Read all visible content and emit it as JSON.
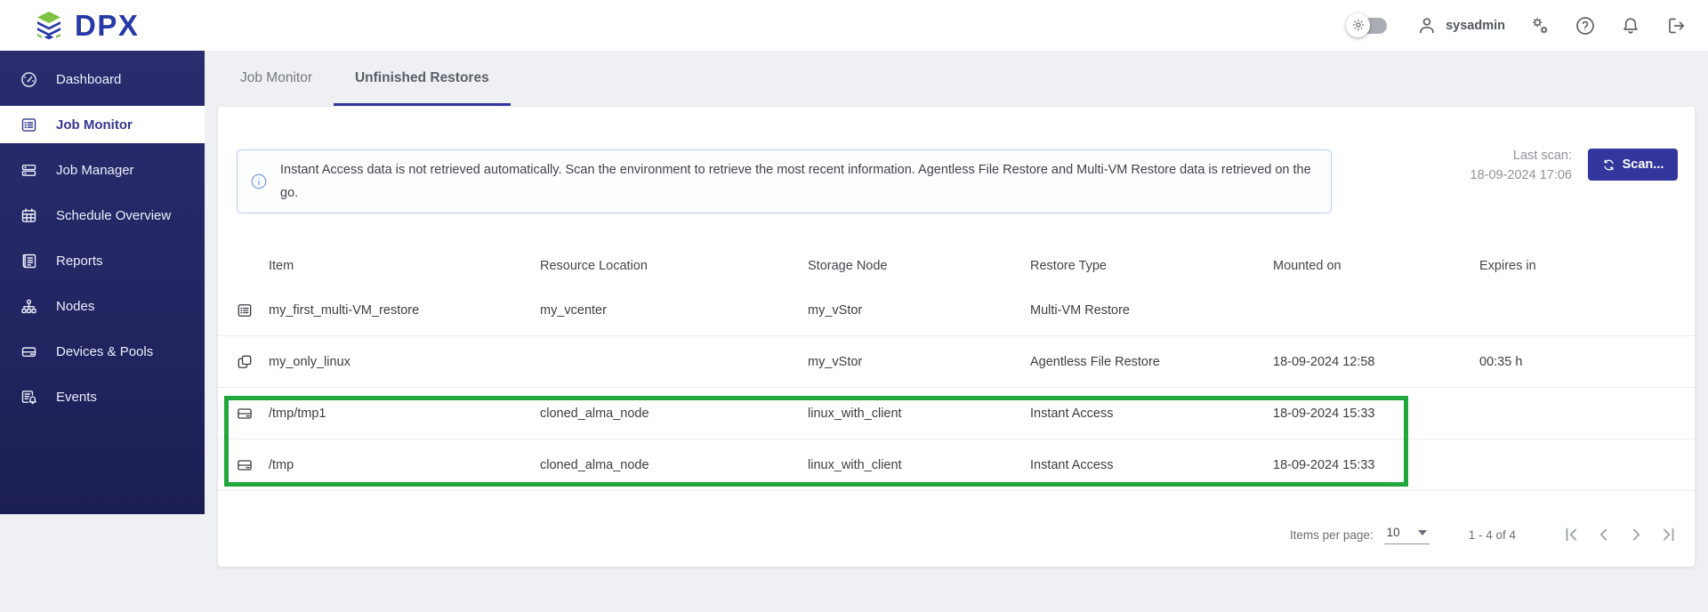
{
  "brand": {
    "name": "DPX"
  },
  "topbar": {
    "username": "sysadmin"
  },
  "sidebar": {
    "items": [
      {
        "label": "Dashboard",
        "active": false
      },
      {
        "label": "Job Monitor",
        "active": true
      },
      {
        "label": "Job Manager",
        "active": false
      },
      {
        "label": "Schedule Overview",
        "active": false
      },
      {
        "label": "Reports",
        "active": false
      },
      {
        "label": "Nodes",
        "active": false
      },
      {
        "label": "Devices & Pools",
        "active": false
      },
      {
        "label": "Events",
        "active": false
      }
    ]
  },
  "tabs": [
    {
      "label": "Job Monitor",
      "active": false
    },
    {
      "label": "Unfinished Restores",
      "active": true
    }
  ],
  "banner": {
    "text": "Instant Access data is not retrieved automatically. Scan the environment to retrieve the most recent information. Agentless File Restore and Multi-VM Restore data is retrieved on the go."
  },
  "scan": {
    "last_scan_label": "Last scan:",
    "last_scan_time": "18-09-2024 17:06",
    "button_label": "Scan..."
  },
  "table": {
    "columns": [
      "Item",
      "Resource Location",
      "Storage Node",
      "Restore Type",
      "Mounted on",
      "Expires in"
    ],
    "rows": [
      {
        "icon": "multi-vm-list",
        "item": "my_first_multi-VM_restore",
        "resource_location": "my_vcenter",
        "storage_node": "my_vStor",
        "restore_type": "Multi-VM Restore",
        "mounted_on": "",
        "expires_in": "",
        "highlighted": false
      },
      {
        "icon": "copy",
        "item": "my_only_linux",
        "resource_location": "",
        "storage_node": "my_vStor",
        "restore_type": "Agentless File Restore",
        "mounted_on": "18-09-2024 12:58",
        "expires_in": "00:35 h",
        "highlighted": false
      },
      {
        "icon": "disk",
        "item": "/tmp/tmp1",
        "resource_location": "cloned_alma_node",
        "storage_node": "linux_with_client",
        "restore_type": "Instant Access",
        "mounted_on": "18-09-2024 15:33",
        "expires_in": "",
        "highlighted": true
      },
      {
        "icon": "disk",
        "item": "/tmp",
        "resource_location": "cloned_alma_node",
        "storage_node": "linux_with_client",
        "restore_type": "Instant Access",
        "mounted_on": "18-09-2024 15:33",
        "expires_in": "",
        "highlighted": true
      }
    ]
  },
  "pagination": {
    "items_per_page_label": "Items per page:",
    "page_size": "10",
    "range": "1 - 4 of 4"
  },
  "colors": {
    "accent": "#33369b",
    "sidebar_navy": "#292d6e",
    "logo_blue": "#2639a6",
    "logo_green": "#7dc242",
    "highlight_green": "#1fa73c",
    "banner_border": "#b9cdf4",
    "page_background": "#eef0f4"
  }
}
